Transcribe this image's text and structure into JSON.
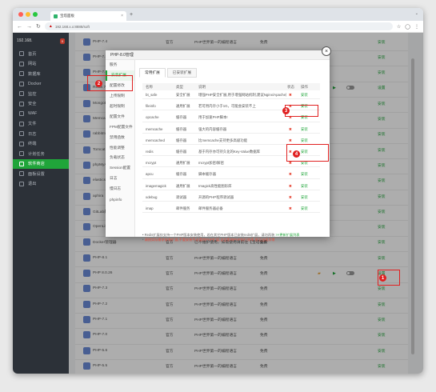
{
  "browser": {
    "tab_title": "宝塔面板",
    "url": "192.168.x.x:8888/soft",
    "colors": {
      "red": "#ff5f57",
      "yellow": "#febc2e",
      "green": "#28c840"
    }
  },
  "sidebar": {
    "server_label": "192.168.",
    "badge": "0",
    "items": [
      {
        "label": "首页",
        "icon": "home-icon"
      },
      {
        "label": "网站",
        "icon": "globe-icon"
      },
      {
        "label": "数据库",
        "icon": "database-icon"
      },
      {
        "label": "Docker",
        "icon": "docker-icon"
      },
      {
        "label": "监控",
        "icon": "monitor-icon"
      },
      {
        "label": "安全",
        "icon": "shield-icon"
      },
      {
        "label": "WAF",
        "icon": "waf-icon"
      },
      {
        "label": "文件",
        "icon": "folder-icon"
      },
      {
        "label": "日志",
        "icon": "log-icon"
      },
      {
        "label": "终端",
        "icon": "terminal-icon"
      },
      {
        "label": "计划任务",
        "icon": "clock-icon"
      },
      {
        "label": "软件商店",
        "icon": "store-icon"
      },
      {
        "label": "面板设置",
        "icon": "settings-icon"
      },
      {
        "label": "退出",
        "icon": "logout-icon"
      }
    ],
    "active_index": 11
  },
  "table": {
    "rows": [
      {
        "name": "PHP-7.4",
        "dev": "官方",
        "desc": "PHP世界第一的编程语言",
        "price": "免费",
        "op": "安装"
      },
      {
        "name": "PHP-7.3",
        "dev": "官方",
        "desc": "PHP世界第一的编程语言",
        "price": "免费",
        "op": "安装"
      },
      {
        "name": "PHP-7.2",
        "dev": "官方",
        "desc": "PHP世界第一的编程语言",
        "price": "免费",
        "op": "安装"
      },
      {
        "name": "Redis 7.0",
        "dev": "官方",
        "desc": "Redis 是一个高性能的key-value数据库",
        "price": "免费",
        "op": "设置"
      },
      {
        "name": "MongoDB",
        "dev": "官方",
        "desc": "MongoDB 是一个基于分布式文件存储",
        "price": "免费",
        "op": "安装"
      },
      {
        "name": "Memcached",
        "dev": "官方",
        "desc": "Memcached 是一个高性能的分布式内存",
        "price": "免费",
        "op": "安装"
      },
      {
        "name": "rabbitmq",
        "dev": "官方",
        "desc": "RabbitMQ 消息队列",
        "price": "免费",
        "op": "安装"
      },
      {
        "name": "Tomcat",
        "dev": "官方",
        "desc": "开源的 Web 应用服务器",
        "price": "免费",
        "op": "安装"
      },
      {
        "name": "phpMyAdmin",
        "dev": "官方",
        "desc": "著名Web端MySQL管理工具",
        "price": "免费",
        "op": "安装"
      },
      {
        "name": "elasticsearch",
        "dev": "官方",
        "desc": "Elasticsearch 搜索引擎",
        "price": "免费",
        "op": "安装"
      },
      {
        "name": "aphira",
        "dev": "官方",
        "desc": "aphira",
        "price": "免费",
        "op": "安装"
      },
      {
        "name": "GitLab最新",
        "dev": "官方",
        "desc": "GitLab 代码托管平台",
        "price": "免费",
        "op": "安装"
      },
      {
        "name": "OpenLiteSpeed",
        "dev": "官方",
        "desc": "OpenLiteSpeed",
        "price": "免费",
        "op": "安装"
      },
      {
        "name": "Docker管理器",
        "dev": "官方",
        "desc": "已不维护使用，如需使用请前往【宝塔面板->Docker】",
        "price": "免费",
        "op": "安装"
      },
      {
        "name": "PHP-8.1",
        "dev": "官方",
        "desc": "PHP世界第一的编程语言",
        "price": "免费",
        "op": "安装"
      },
      {
        "name": "PHP 8.0.26",
        "dev": "官方",
        "desc": "PHP世界第一的编程语言",
        "price": "免费",
        "op": "设置"
      },
      {
        "name": "PHP-7.3",
        "dev": "官方",
        "desc": "PHP世界第一的编程语言",
        "price": "免费",
        "op": "安装"
      },
      {
        "name": "PHP-7.2",
        "dev": "官方",
        "desc": "PHP世界第一的编程语言",
        "price": "免费",
        "op": "安装"
      },
      {
        "name": "PHP-7.1",
        "dev": "官方",
        "desc": "PHP世界第一的编程语言",
        "price": "免费",
        "op": "安装"
      },
      {
        "name": "PHP-7.0",
        "dev": "官方",
        "desc": "PHP世界第一的编程语言",
        "price": "免费",
        "op": "安装"
      },
      {
        "name": "PHP-5.6",
        "dev": "官方",
        "desc": "PHP世界第一的编程语言",
        "price": "免费",
        "op": "安装"
      },
      {
        "name": "PHP-5.5",
        "dev": "官方",
        "desc": "PHP世界第一的编程语言",
        "price": "免费",
        "op": "安装"
      }
    ],
    "ops_row3": [
      "设置",
      "卸载"
    ],
    "docker_warning": "请更新到7.9.3以上版本使用"
  },
  "modal": {
    "title": "PHP-8.0管理",
    "side": [
      "服务",
      "安装扩展",
      "配置修改",
      "上传限制",
      "超时限制",
      "配置文件",
      "FPM配置文件",
      "禁用函数",
      "性能调整",
      "负载状态",
      "Session配置",
      "日志",
      "慢日志",
      "phpinfo"
    ],
    "side_active": 1,
    "subtabs": [
      "常用扩展",
      "已安装扩展"
    ],
    "head": {
      "name": "名称",
      "type": "类型",
      "desc": "说明",
      "status": "状态",
      "op": "操作"
    },
    "exts": [
      {
        "name": "bt_safe",
        "type": "安全扩展",
        "desc": "增强PHP安全扩展,用于增强网站机制,建议Nginx/Apache用户安装",
        "st": "✖",
        "op": "安装"
      },
      {
        "name": "fileinfo",
        "type": "通用扩展",
        "desc": "若可用内存小于1G，可能会安装不上",
        "st": "✖",
        "op": "安装"
      },
      {
        "name": "opcache",
        "type": "缓存器",
        "desc": "用于加速PHP脚本!",
        "st": "✖",
        "op": "安装"
      },
      {
        "name": "memcache",
        "type": "缓存器",
        "desc": "强大的内容缓存器",
        "st": "✖",
        "op": "安装"
      },
      {
        "name": "memcached",
        "type": "缓存器",
        "desc": "比memcache支持更多高级功能",
        "st": "✖",
        "op": "安装"
      },
      {
        "name": "redis",
        "type": "缓存器",
        "desc": "基于内存亦可持久化的Key-Value数据库",
        "st": "✖",
        "op": "安装"
      },
      {
        "name": "mcrypt",
        "type": "通用扩展",
        "desc": "mcrypt加密/解密",
        "st": "✖",
        "op": "安装"
      },
      {
        "name": "apcu",
        "type": "缓存器",
        "desc": "脚本缓存器",
        "st": "✖",
        "op": "安装"
      },
      {
        "name": "imagemagick",
        "type": "通用扩展",
        "desc": "Imagick高性能图形库",
        "st": "✖",
        "op": "安装"
      },
      {
        "name": "xdebug",
        "type": "调试器",
        "desc": "开源的PHP程序调试器",
        "st": "✖",
        "op": "安装"
      },
      {
        "name": "imap",
        "type": "邮件服务",
        "desc": "邮件服务器必备",
        "st": "✖",
        "op": "安装"
      }
    ],
    "note1": "Redis扩展仅支持一个PHP版本安装使用，若在其它PHP版本已安装redis扩展，请勿再装",
    "note1_link": ">>更新扩展列表",
    "note2": "请按实际需求安装扩展,不要安装不必要的PHP扩展,这会影响PHP执行效率,甚至出现异常"
  },
  "markers": [
    "1",
    "2",
    "3",
    "4"
  ]
}
